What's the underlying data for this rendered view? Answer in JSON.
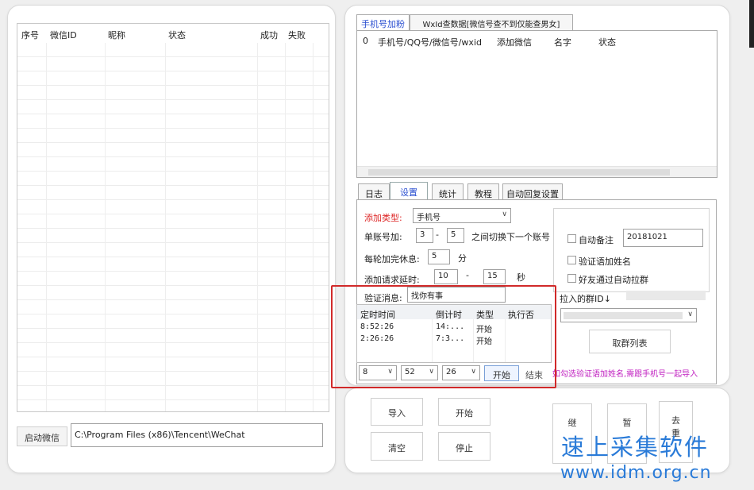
{
  "left": {
    "columns": [
      "序号",
      "微信ID",
      "昵称",
      "状态",
      "成功",
      "失败"
    ],
    "start_wechat_label": "启动微信",
    "wechat_path": "C:\\Program Files (x86)\\Tencent\\WeChat"
  },
  "right": {
    "top_tabs": [
      "手机号加粉",
      "WxId查数据[微信号查不到仅能查男女]"
    ],
    "list_columns": [
      "0",
      "手机号/QQ号/微信号/wxid",
      "添加微信",
      "名字",
      "状态"
    ],
    "subtabs": [
      "日志",
      "设置",
      "统计",
      "教程",
      "自动回复设置"
    ],
    "settings": {
      "add_type_label": "添加类型:",
      "add_type_value": "手机号",
      "per_account_label": "单账号加:",
      "per_account_min": "3",
      "per_account_dash": "-",
      "per_account_max": "5",
      "per_account_suffix": "之间切换下一个账号",
      "rest_label": "每轮加完休息:",
      "rest_value": "5",
      "rest_unit": "分",
      "delay_label": "添加请求延时:",
      "delay_min": "10",
      "delay_dash": "-",
      "delay_max": "15",
      "delay_unit": "秒",
      "verify_label": "验证消息:",
      "verify_value": "找你有事",
      "auto_note_label": "自动备注",
      "auto_note_value": "20181021",
      "verify_name_label": "验证语加姓名",
      "friend_auto_pull_label": "好友通过自动拉群",
      "group_id_label": "拉入的群ID↓",
      "fetch_groups_label": "取群列表"
    },
    "schedule": {
      "columns": [
        "定时时间",
        "倒计时",
        "类型",
        "执行否"
      ],
      "rows": [
        {
          "time": "8:52:26",
          "countdown": "14:...",
          "type": "开始"
        },
        {
          "time": "2:26:26",
          "countdown": "7:3...",
          "type": "开始"
        }
      ]
    },
    "bottom_controls": {
      "hour": "8",
      "minute": "52",
      "second": "26",
      "start_label": "开始",
      "end_label": "结束",
      "hint": "如勾选验证语加姓名,需跟手机号一起导入"
    },
    "actions": [
      "导入",
      "开始",
      "清空",
      "停止",
      "继",
      "暂",
      "去\n重"
    ]
  },
  "watermark": {
    "line1": "速上采集软件",
    "line2": "www.idm.org.cn"
  },
  "colors": {
    "accent": "#2a4fd0",
    "highlight": "#d12a2a",
    "hint": "#c020c0",
    "watermark": "#2a7bd8",
    "add_type_label": "#d22"
  }
}
